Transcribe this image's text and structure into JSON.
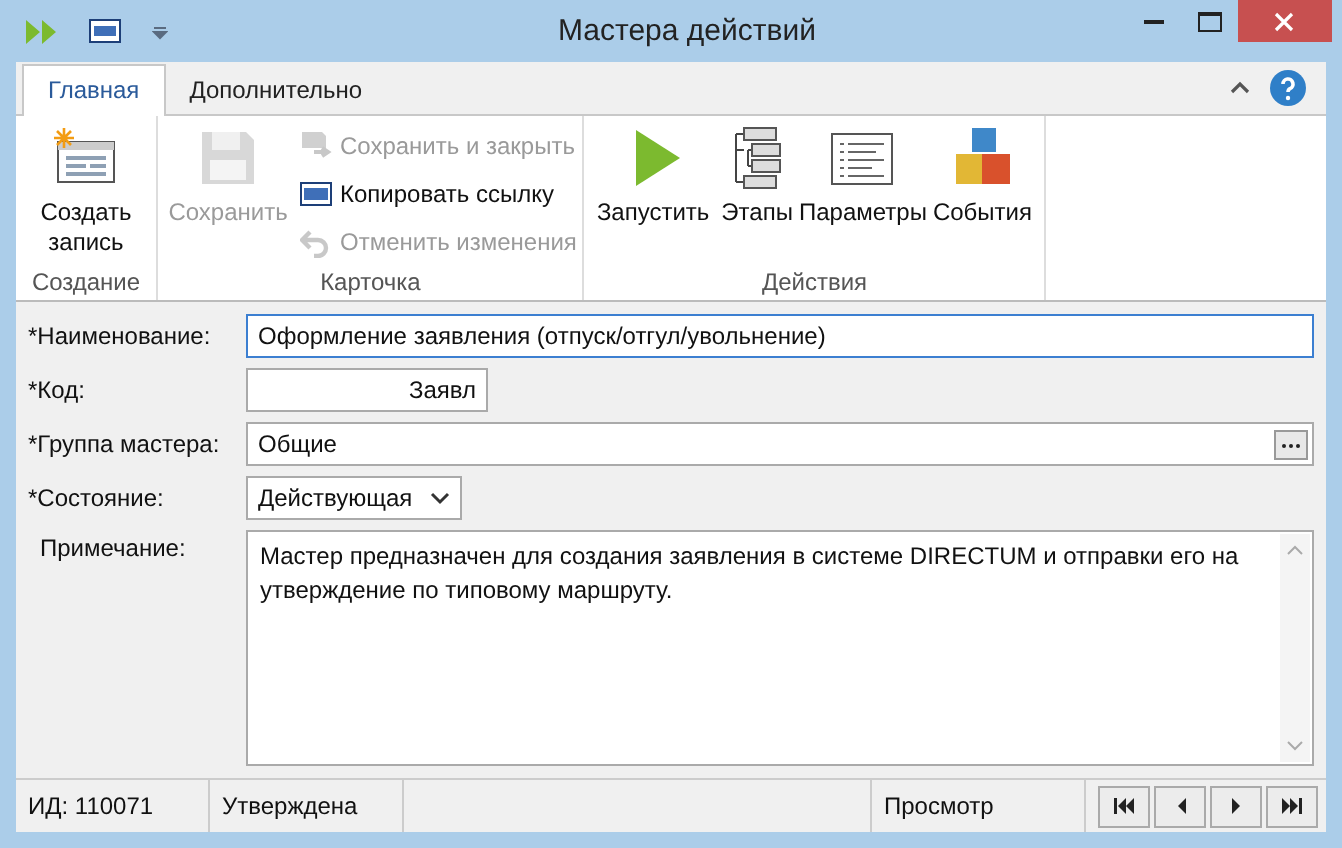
{
  "window": {
    "title": "Мастера действий"
  },
  "tabs": [
    {
      "label": "Главная",
      "selected": true
    },
    {
      "label": "Дополнительно",
      "selected": false
    }
  ],
  "ribbon_groups": [
    {
      "label": "Создание",
      "buttons": [
        {
          "label": "Создать запись",
          "kind": "large",
          "disabled": false
        }
      ]
    },
    {
      "label": "Карточка",
      "buttons": [
        {
          "label": "Сохранить",
          "kind": "large",
          "disabled": true
        },
        {
          "label": "Сохранить и закрыть",
          "kind": "small",
          "disabled": true
        },
        {
          "label": "Копировать ссылку",
          "kind": "small",
          "disabled": false
        },
        {
          "label": "Отменить изменения",
          "kind": "small",
          "disabled": true
        }
      ]
    },
    {
      "label": "Действия",
      "buttons": [
        {
          "label": "Запустить",
          "kind": "large",
          "disabled": false
        },
        {
          "label": "Этапы",
          "kind": "large",
          "disabled": false
        },
        {
          "label": "Параметры",
          "kind": "large",
          "disabled": false
        },
        {
          "label": "События",
          "kind": "large",
          "disabled": false
        }
      ]
    }
  ],
  "fields": [
    {
      "label": "*Наименование:",
      "value": "Оформление заявления (отпуск/отгул/увольнение)",
      "kind": "text",
      "focused": true
    },
    {
      "label": "*Код:",
      "value": "Заявл",
      "kind": "code",
      "focused": false
    },
    {
      "label": "*Группа мастера:",
      "value": "Общие",
      "kind": "lookup",
      "focused": false
    },
    {
      "label": "*Состояние:",
      "value": "Действующая",
      "kind": "select",
      "focused": false
    },
    {
      "label": "Примечание:",
      "value": "Мастер предназначен для создания заявления в системе DIRECTUM и отправки его на утверждение по типовому маршруту.",
      "kind": "memo",
      "focused": false
    }
  ],
  "status_bar": {
    "id": "ИД: 110071",
    "state": "Утверждена",
    "mode": "Просмотр"
  }
}
